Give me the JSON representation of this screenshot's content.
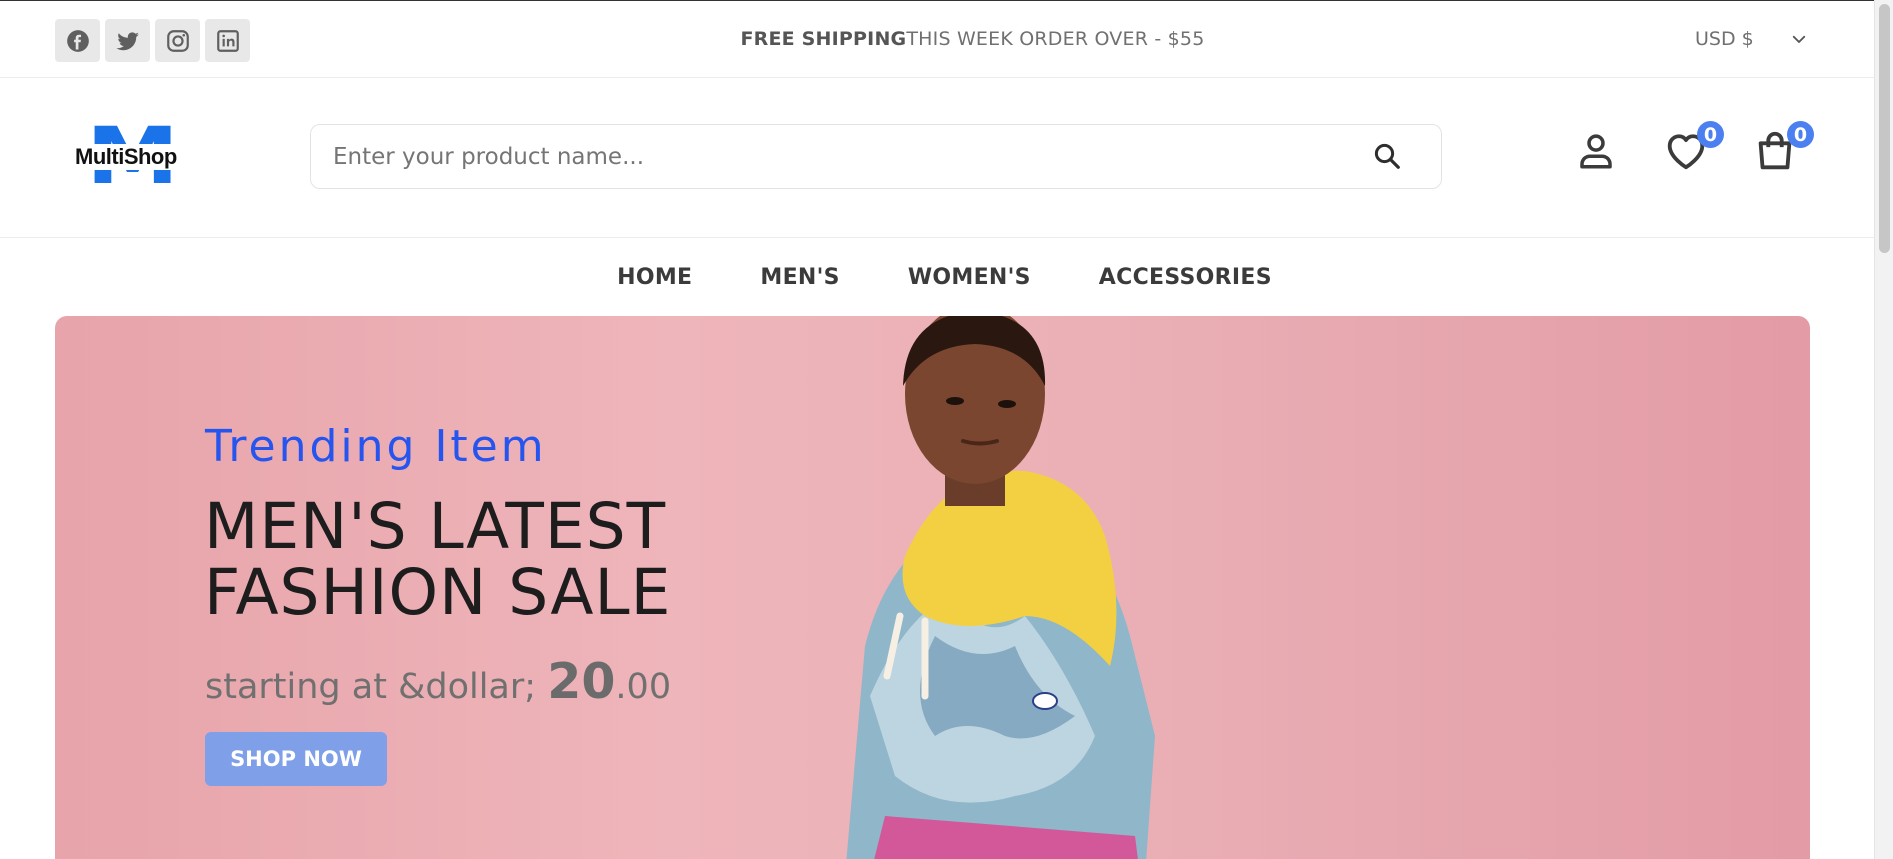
{
  "topbar": {
    "socials": [
      {
        "icon": "facebook-icon"
      },
      {
        "icon": "twitter-icon"
      },
      {
        "icon": "instagram-icon"
      },
      {
        "icon": "linkedin-icon"
      }
    ],
    "announcement_bold": "FREE SHIPPING",
    "announcement_rest": "THIS WEEK ORDER OVER - $55",
    "currency": "USD $"
  },
  "header": {
    "logo_text": "MultiShop",
    "logo_letter": "M",
    "search_placeholder": "Enter your product name...",
    "wishlist_count": "0",
    "cart_count": "0"
  },
  "nav": {
    "items": [
      {
        "label": "HOME"
      },
      {
        "label": "MEN'S"
      },
      {
        "label": "WOMEN'S"
      },
      {
        "label": "ACCESSORIES"
      }
    ]
  },
  "hero": {
    "subtitle": "Trending Item",
    "title": "MEN'S LATEST FASHION SALE",
    "price_prefix": "starting at &dollar;",
    "price_whole": "20",
    "price_cents": ".00",
    "button_label": "SHOP NOW"
  },
  "colors": {
    "accent": "#2554ef",
    "badge": "#4c7ff0",
    "hero_bg": "#eab0b6",
    "button_bg": "#7f9fe8"
  }
}
